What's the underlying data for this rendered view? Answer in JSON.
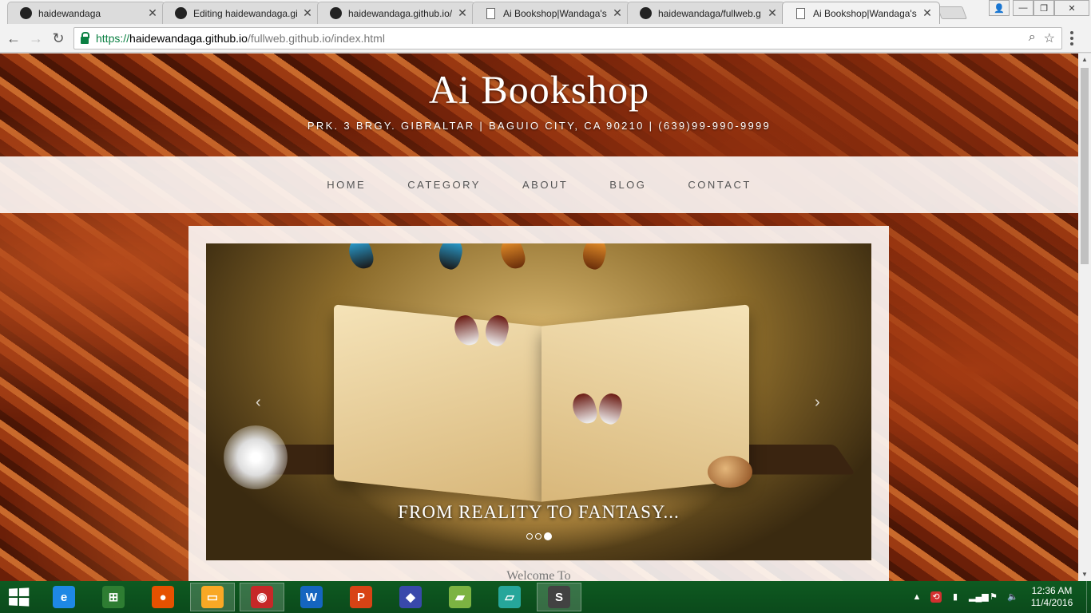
{
  "browser": {
    "tabs": [
      {
        "title": "haidewandaga",
        "icon": "github-icon"
      },
      {
        "title": "Editing haidewandaga.gi",
        "icon": "github-icon"
      },
      {
        "title": "haidewandaga.github.io/",
        "icon": "github-icon"
      },
      {
        "title": "Ai Bookshop|Wandaga's",
        "icon": "document-icon"
      },
      {
        "title": "haidewandaga/fullweb.g",
        "icon": "github-icon"
      },
      {
        "title": "Ai Bookshop|Wandaga's",
        "icon": "document-icon",
        "active": true
      }
    ],
    "url": {
      "scheme": "https://",
      "host": "haidewandaga.github.io",
      "path": "/fullweb.github.io/index.html"
    }
  },
  "site": {
    "title": "Ai Bookshop",
    "address": "PRK. 3 BRGY. GIBRALTAR | BAGUIO CITY, CA 90210 | (639)99-990-9999",
    "nav": [
      "HOME",
      "CATEGORY",
      "ABOUT",
      "BLOG",
      "CONTACT"
    ],
    "carousel": {
      "caption": "FROM REALITY TO FANTASY...",
      "prev": "‹",
      "next": "›",
      "slides": 3,
      "active_slide": 3
    },
    "welcome": "Welcome To"
  },
  "taskbar": {
    "apps": [
      {
        "name": "internet-explorer",
        "glyph": "e",
        "color": "#1e88e5"
      },
      {
        "name": "store",
        "glyph": "⊞",
        "color": "#2e7d32"
      },
      {
        "name": "firefox",
        "glyph": "●",
        "color": "#e65100"
      },
      {
        "name": "file-explorer",
        "glyph": "▭",
        "color": "#f9a825",
        "running": true
      },
      {
        "name": "chrome",
        "glyph": "◉",
        "color": "#c62828",
        "running": true
      },
      {
        "name": "word",
        "glyph": "W",
        "color": "#1565c0"
      },
      {
        "name": "powerpoint",
        "glyph": "P",
        "color": "#d84315"
      },
      {
        "name": "virtualbox",
        "glyph": "◆",
        "color": "#3949ab"
      },
      {
        "name": "folder-sync",
        "glyph": "▰",
        "color": "#7cb342"
      },
      {
        "name": "notes",
        "glyph": "▱",
        "color": "#26a69a"
      },
      {
        "name": "sublime-text",
        "glyph": "S",
        "color": "#424242",
        "running": true
      }
    ],
    "time": "12:36 AM",
    "date": "11/4/2016"
  }
}
